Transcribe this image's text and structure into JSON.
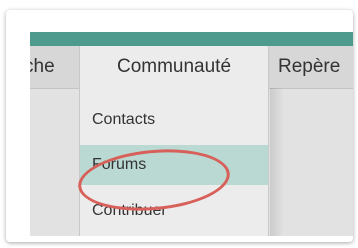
{
  "colors": {
    "teal_bar": "#4e9a8d",
    "forums_highlight": "#b9d9d2",
    "ellipse": "#d8605a"
  },
  "nav": {
    "items": [
      {
        "label": "che"
      },
      {
        "label": "Communauté"
      },
      {
        "label": "Repère"
      }
    ]
  },
  "dropdown": {
    "items": [
      {
        "label": "Contacts"
      },
      {
        "label": "Forums",
        "selected": true
      },
      {
        "label": "Contribuer"
      }
    ]
  }
}
